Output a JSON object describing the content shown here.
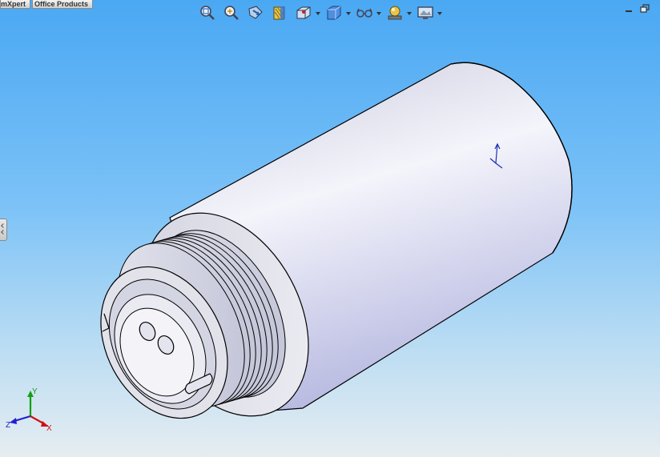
{
  "tabs": [
    "mXpert",
    "Office Products"
  ],
  "toolbar": {
    "buttons": [
      {
        "icon": "zoom-to-fit-icon"
      },
      {
        "icon": "zoom-to-area-icon"
      },
      {
        "icon": "previous-view-icon"
      },
      {
        "icon": "section-view-icon"
      },
      {
        "icon": "view-orientation-icon",
        "dropdown": true
      },
      {
        "icon": "display-style-icon",
        "dropdown": true
      },
      {
        "icon": "hide-show-items-icon",
        "dropdown": true
      },
      {
        "icon": "edit-appearance-icon",
        "dropdown": true
      },
      {
        "icon": "apply-scene-icon",
        "dropdown": true
      }
    ]
  },
  "window_controls": [
    "minimize-icon",
    "restore-icon"
  ],
  "triad": {
    "x": "X",
    "y": "Y",
    "z": "Z"
  },
  "colors": {
    "viewport_top": "#4aa8f3",
    "viewport_bottom": "#e6edf1",
    "part_body": "#dcdff0",
    "edges": "#000000",
    "triad_x": "#d01010",
    "triad_y": "#10a010",
    "triad_z": "#2020d0"
  }
}
